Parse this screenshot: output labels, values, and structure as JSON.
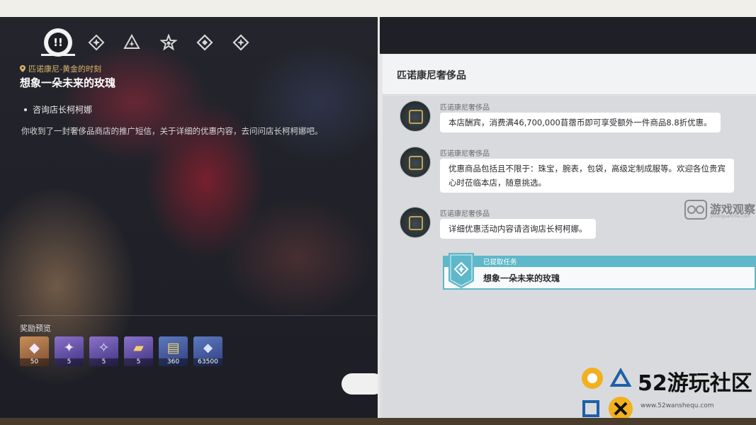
{
  "left": {
    "tabs": [
      {
        "icon": "alert-quest-icon",
        "active": true
      },
      {
        "icon": "diamond-star-icon"
      },
      {
        "icon": "triangle-star-icon"
      },
      {
        "icon": "star-icon"
      },
      {
        "icon": "diamond-icon"
      },
      {
        "icon": "diamond-small-icon"
      }
    ],
    "location": "匹诺康尼-黄金的时刻",
    "quest_title": "想象一朵未来的玫瑰",
    "objective": "咨询店长柯柯娜",
    "description": "你收到了一封奢侈品商店的推广短信，关于详细的优惠内容，去问问店长柯柯娜吧。",
    "reward_label": "奖励预览",
    "rewards": [
      {
        "icon": "crystal-icon",
        "count": "50"
      },
      {
        "icon": "purple-gem-icon",
        "count": "5"
      },
      {
        "icon": "blade-material-icon",
        "count": "5"
      },
      {
        "icon": "gold-material-icon",
        "count": "5"
      },
      {
        "icon": "credits-icon",
        "count": "360"
      },
      {
        "icon": "exp-material-icon",
        "count": "63500"
      }
    ]
  },
  "right": {
    "header_title": "匹诺康尼奢侈品",
    "messages": [
      {
        "sender": "匹诺康尼奢侈品",
        "lines": [
          "本店酬宾，消费满46,700,000苜蓿币即可享受额外一件商品8.8折优惠。"
        ]
      },
      {
        "sender": "匹诺康尼奢侈品",
        "lines": [
          "优惠商品包括且不限于：珠宝，腕表，包袋，高级定制成服等。欢迎各位贵宾",
          "心时莅临本店，随意挑选。"
        ]
      },
      {
        "sender": "匹诺康尼奢侈品",
        "lines": [
          "详细优惠活动内容请咨询店长柯柯娜。"
        ]
      }
    ],
    "task": {
      "label": "已提取任务",
      "name": "想象一朵未来的玫瑰"
    }
  },
  "watermarks": {
    "gamebiz": "游戏观察",
    "gamebiz_sub": "youxiguancha.com",
    "site52": "52游玩社区",
    "site52_url": "www.52wanshequ.com"
  },
  "colors": {
    "accent_gold": "#d9b46b",
    "task_teal": "#5eb8c9",
    "bubble_bg": "#ffffff"
  }
}
